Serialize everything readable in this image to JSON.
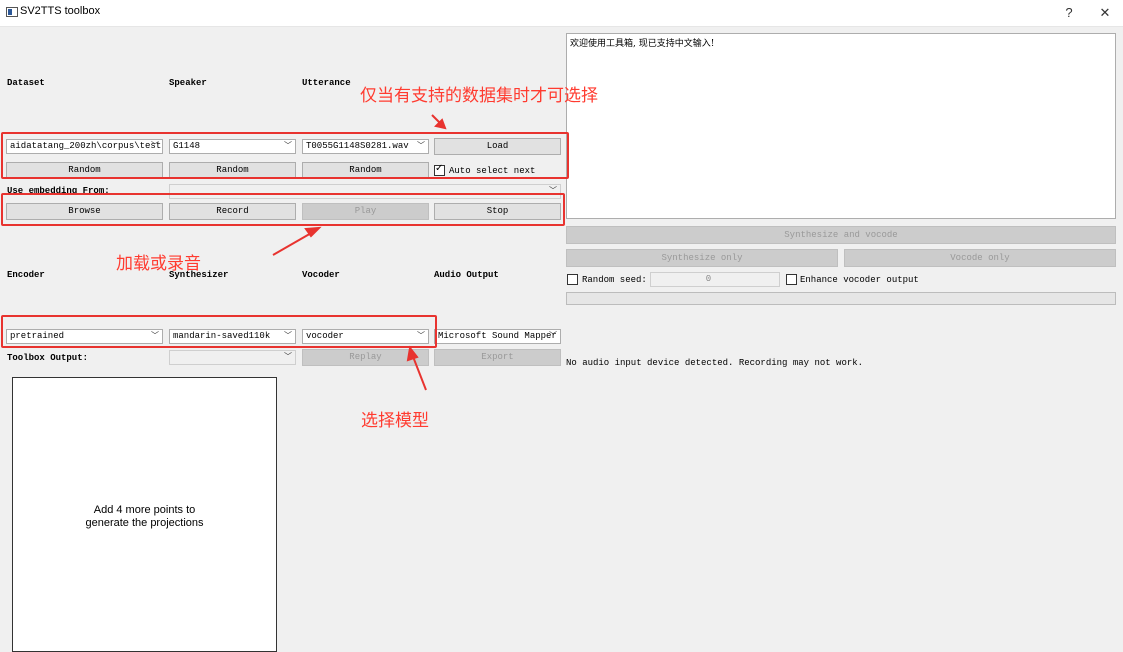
{
  "window": {
    "title": "SV2TTS toolbox",
    "help_label": "?",
    "close_label": "✕"
  },
  "dataset_section": {
    "dataset_label": "Dataset",
    "speaker_label": "Speaker",
    "utterance_label": "Utterance",
    "dataset_value": "aidatatang_200zh\\corpus\\test",
    "speaker_value": "G1148",
    "utterance_value": "T0055G1148S0281.wav",
    "load_label": "Load",
    "random_dataset_label": "Random",
    "random_speaker_label": "Random",
    "random_utterance_label": "Random",
    "auto_select_label": "Auto select next",
    "auto_select_checked": true,
    "use_embedding_label": "Use embedding From:",
    "use_embedding_value": "",
    "browse_label": "Browse",
    "record_label": "Record",
    "play_label": "Play",
    "stop_label": "Stop"
  },
  "model_section": {
    "encoder_label": "Encoder",
    "synthesizer_label": "Synthesizer",
    "vocoder_label": "Vocoder",
    "audio_output_label": "Audio Output",
    "encoder_value": "pretrained",
    "synthesizer_value": "mandarin-saved110k",
    "vocoder_value": "vocoder",
    "audio_output_value": "Microsoft Sound Mapper",
    "toolbox_output_label": "Toolbox Output:",
    "toolbox_output_value": "",
    "replay_label": "Replay",
    "export_label": "Export",
    "status_text": "No audio input device detected. Recording may not work."
  },
  "synthesis": {
    "text_input": "欢迎使用工具箱, 现已支持中文输入!",
    "synthesize_vocode_label": "Synthesize and vocode",
    "synthesize_only_label": "Synthesize only",
    "vocode_only_label": "Vocode only",
    "random_seed_label": "Random seed:",
    "random_seed_checked": false,
    "seed_value": "0",
    "enhance_label": "Enhance vocoder output",
    "enhance_checked": false
  },
  "projections": {
    "message_line1": "Add 4 more points to",
    "message_line2": "generate the projections"
  },
  "annotations": {
    "dataset_note": "仅当有支持的数据集时才可选择",
    "record_note": "加载或录音",
    "model_note": "选择模型",
    "color": "#e8332f"
  },
  "icons": {
    "dropdown": "chevron-down-icon",
    "check": "check-icon"
  }
}
